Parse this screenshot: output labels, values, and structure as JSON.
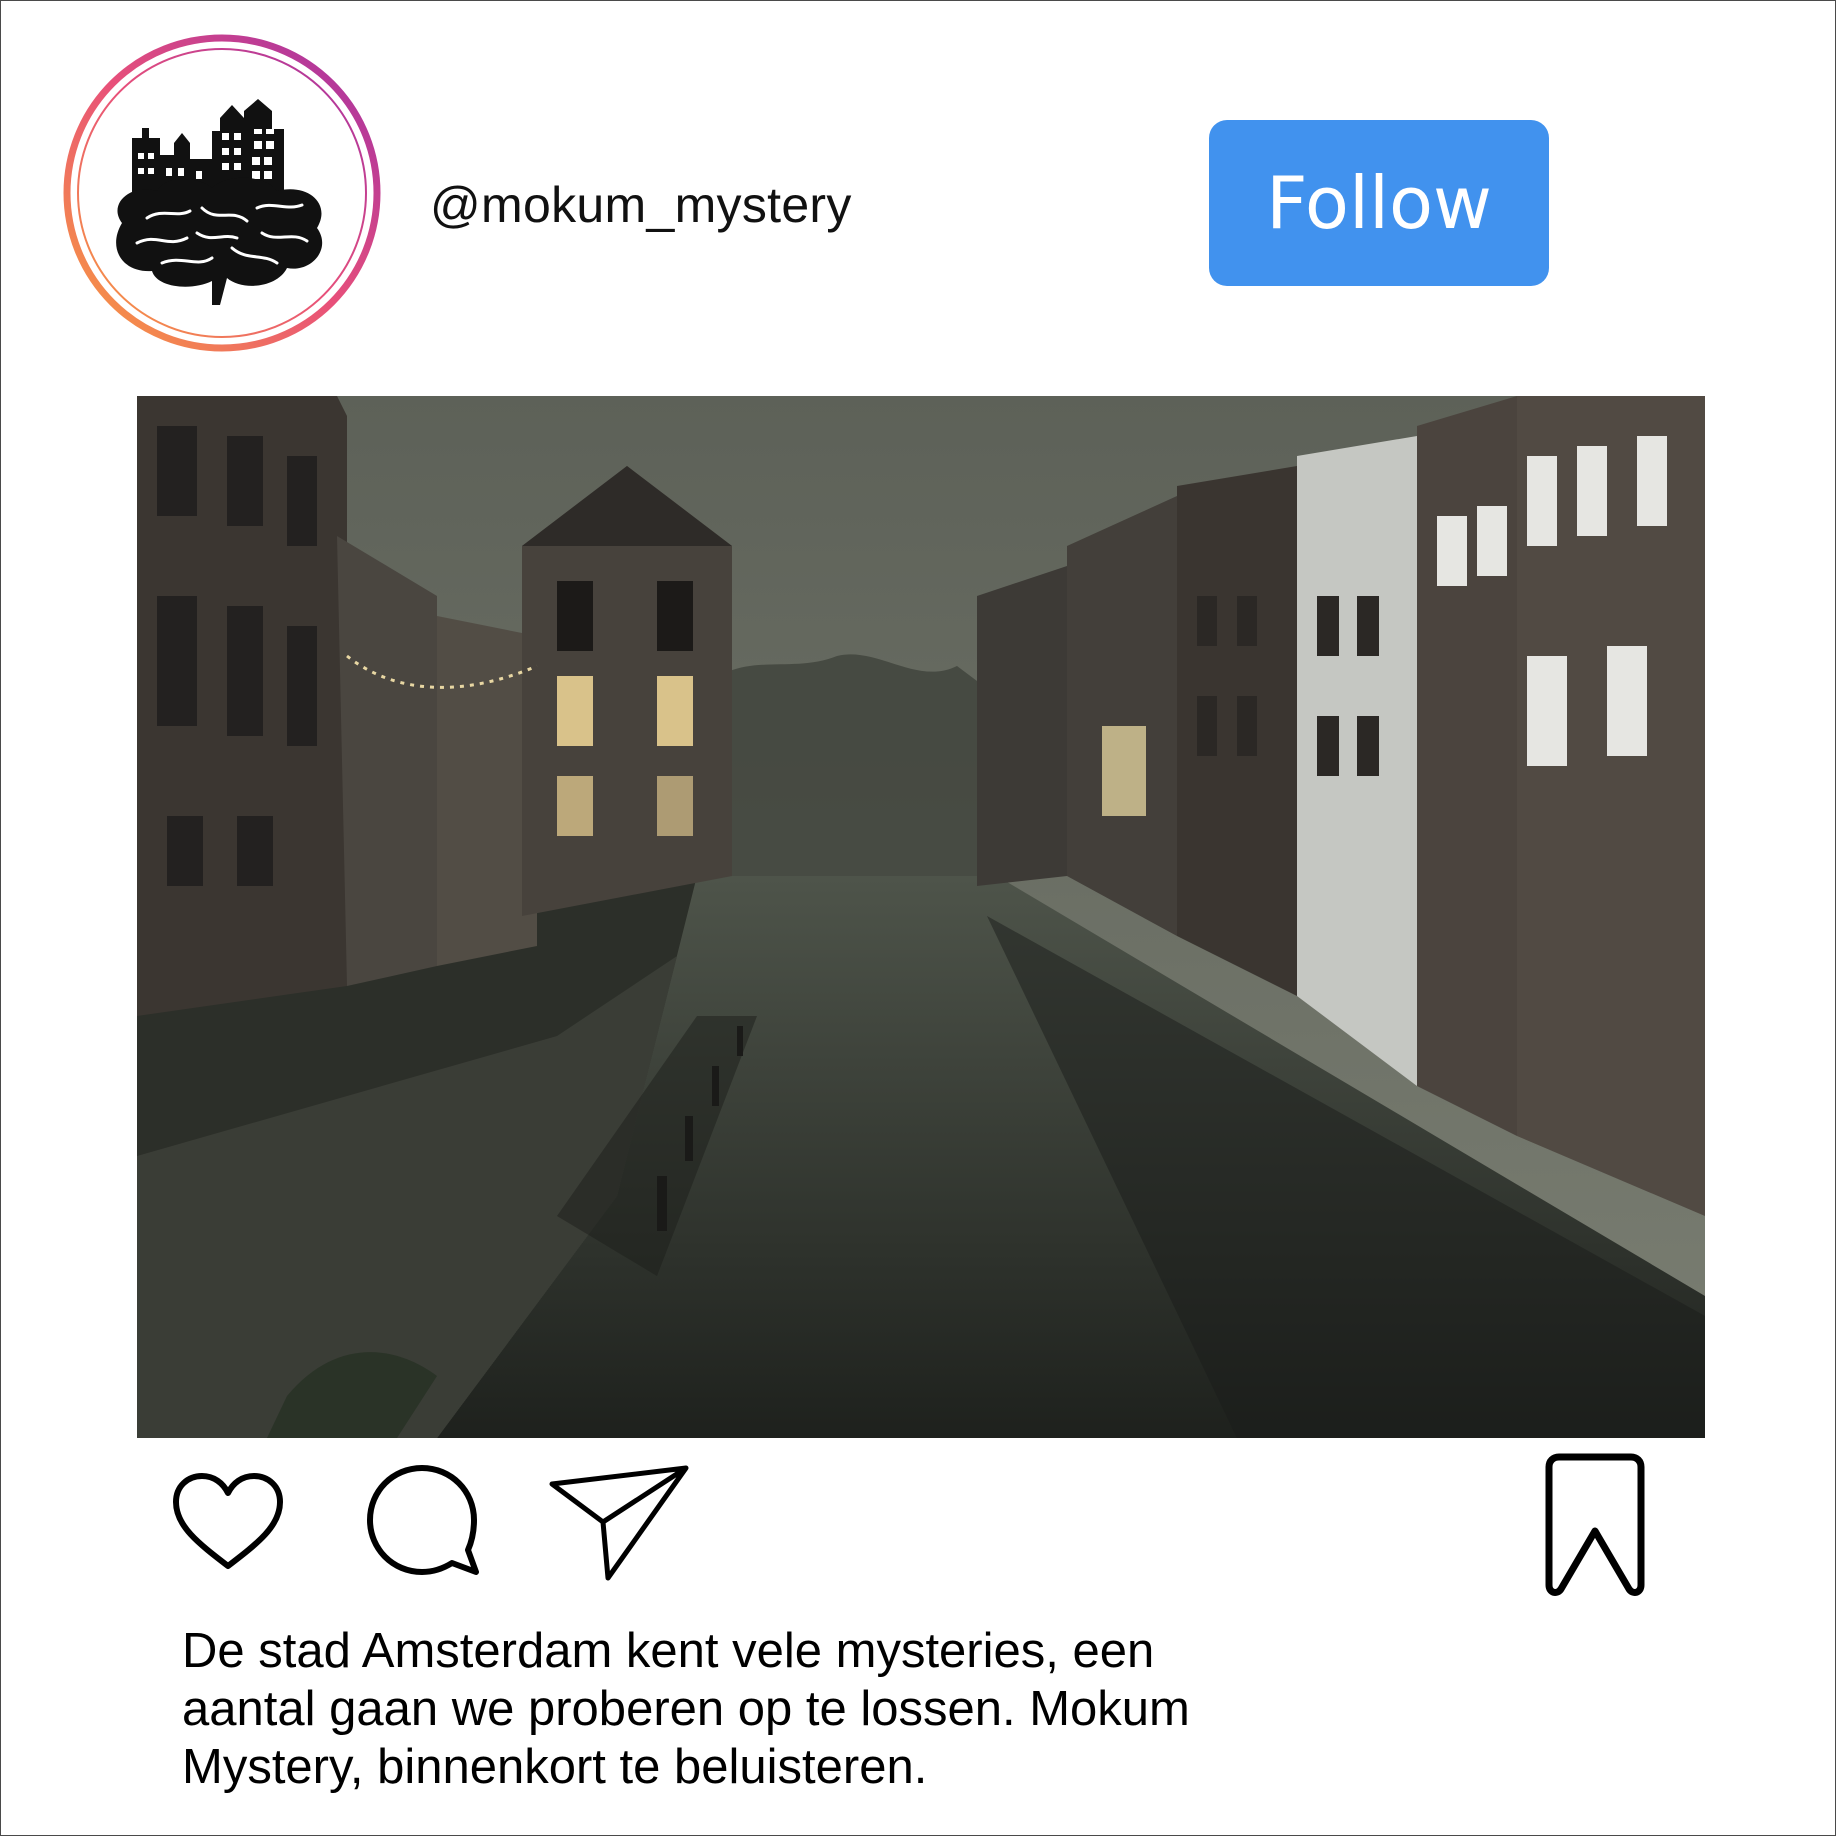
{
  "post": {
    "username": "@mokum_mystery",
    "follow_label": "Follow",
    "caption": "De stad Amsterdam kent vele mysteries, een aantal gaan we proberen op te lossen. Mokum Mystery, binnenkort te beluisteren."
  },
  "colors": {
    "follow_button": "#4192ee",
    "avatar_ring_start": "#f58529",
    "avatar_ring_end": "#a12fa6"
  },
  "icons": {
    "avatar": "amsterdam-brain-logo-icon",
    "like": "heart-icon",
    "comment": "comment-bubble-icon",
    "share": "paper-plane-icon",
    "save": "bookmark-icon"
  }
}
